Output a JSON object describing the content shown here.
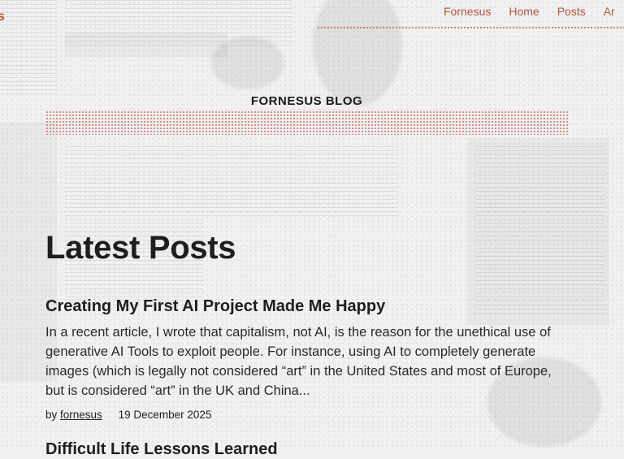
{
  "nav": {
    "logo_fragment": "s",
    "items": [
      "Fornesus",
      "Home",
      "Posts",
      "Ar"
    ]
  },
  "site": {
    "title": "FORNESUS BLOG"
  },
  "main": {
    "heading": "Latest Posts",
    "posts": [
      {
        "title": "Creating My First AI Project Made Me Happy",
        "excerpt": "In a recent article, I wrote that capitalism, not AI, is the reason for the unethical use of generative AI Tools to exploit people. For instance, using AI to completely generate images (which is legally not considered “art” in the United States and most of Europe, but is considered “art” in the UK and China...",
        "by_label": "by",
        "author": "fornesus",
        "date": "19 December 2025"
      },
      {
        "title": "Difficult Life Lessons Learned"
      }
    ]
  },
  "colors": {
    "accent": "#b5533c",
    "text": "#1e1e1e",
    "background": "#f1f1f1"
  }
}
